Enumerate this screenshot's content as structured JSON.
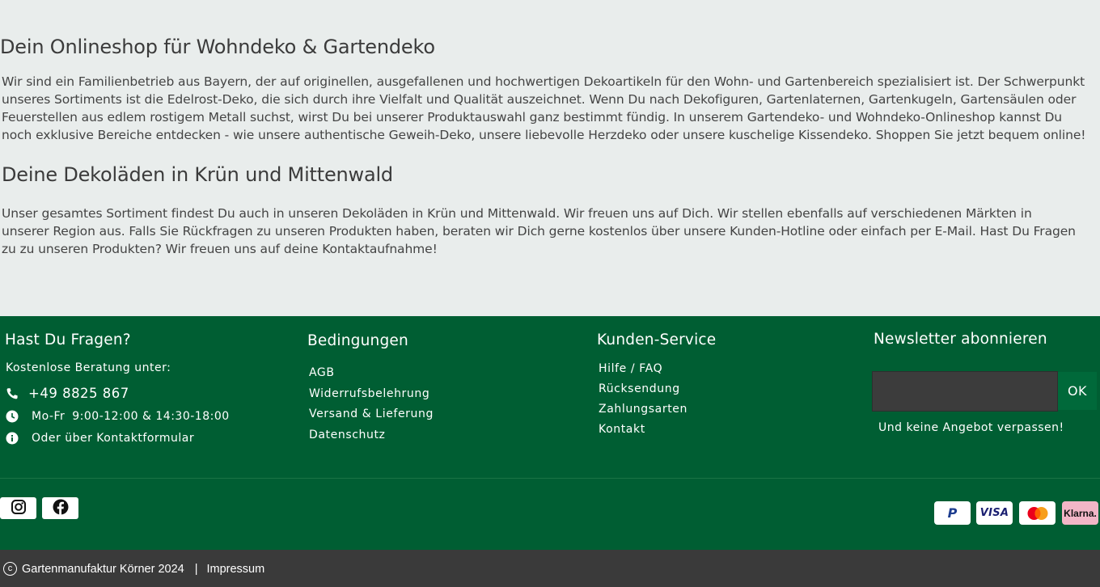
{
  "intro": {
    "heading1": "Dein Onlineshop für Wohndeko & Gartendeko",
    "paragraph1": "Wir sind ein Familienbetrieb aus Bayern, der auf originellen, ausgefallenen und hochwertigen Dekoartikeln für den Wohn- und Gartenbereich spezialisiert ist. Der Schwerpunkt unseres Sortiments ist die Edelrost-Deko, die sich durch ihre Vielfalt und Qualität auszeichnet. Wenn Du nach Dekofiguren, Gartenlaternen, Gartenkugeln, Gartensäulen oder Feuerstellen aus edlem rostigem Metall suchst, wirst Du bei unserer Produktauswahl ganz bestimmt fündig.  In unserem Gartendeko- und Wohndeko-Onlineshop kannst Du noch exklusive Bereiche entdecken - wie unsere authentische Geweih-Deko, unsere liebevolle Herzdeko oder unsere kuschelige Kissendeko. Shoppen Sie jetzt bequem online!",
    "heading2": "Deine Dekoläden in Krün und Mittenwald",
    "paragraph2": "Unser gesamtes Sortiment findest Du auch in unseren Dekoläden in Krün und Mittenwald. Wir freuen uns auf Dich. Wir stellen ebenfalls auf verschiedenen Märkten in unserer Region aus. Falls Sie Rückfragen zu unseren Produkten haben, beraten wir Dich gerne kostenlos über unsere Kunden-Hotline oder einfach per E-Mail. Hast Du Fragen zu zu unseren Produkten? Wir freuen uns auf deine Kontaktaufnahme!"
  },
  "footer": {
    "contact": {
      "title": "Hast Du Fragen?",
      "subtitle": "Kostenlose Beratung unter:",
      "phone": "+49 8825 867",
      "hours_days": "Mo-Fr",
      "hours_times": "9:00-12:00 & 14:30-18:00",
      "form_link": "Oder über Kontaktformular",
      "phone_icon": "phone-icon",
      "clock_icon": "clock-icon",
      "info_icon": "info-icon"
    },
    "conditions": {
      "title": "Bedingungen",
      "links": [
        "AGB",
        "Widerrufsbelehrung",
        "Versand & Lieferung",
        "Datenschutz"
      ]
    },
    "service": {
      "title": "Kunden-Service",
      "links": [
        "Hilfe / FAQ",
        "Rücksendung",
        "Zahlungsarten",
        "Kontakt"
      ]
    },
    "newsletter": {
      "title": "Newsletter abonnieren",
      "input_value": "",
      "button_label": "OK",
      "note": "Und keine Angebot verpassen!"
    },
    "social": [
      "instagram-icon",
      "facebook-icon"
    ],
    "payments": {
      "paypal": "P",
      "visa": "VISA",
      "mastercard": "mastercard",
      "klarna": "Klarna."
    },
    "colors": {
      "footer_bg": "#005e33",
      "bottom_bar_bg": "#3a3a3a",
      "page_bg": "#e9edec"
    }
  },
  "bottom": {
    "copyright_symbol": "c",
    "copyright": "Gartenmanufaktur Körner 2024",
    "separator": "|",
    "impressum": "Impressum"
  }
}
